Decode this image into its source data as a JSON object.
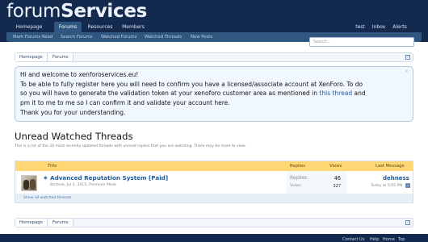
{
  "logo": {
    "prefix": "forum",
    "suffix": "Services"
  },
  "nav": {
    "tabs": [
      "Homepage",
      "Forums",
      "Resources",
      "Members"
    ],
    "account": [
      "test",
      "Inbox",
      "Alerts"
    ],
    "selected": "Forums"
  },
  "subnav": [
    "Mark Forums Read",
    "Search Forums",
    "Watched Forums",
    "Watched Threads",
    "New Posts"
  ],
  "search": {
    "placeholder": "Search..."
  },
  "breadcrumb": [
    "Homepage",
    "Forums"
  ],
  "notice": {
    "line1": "Hi and welcome to xenforoservices.eu!",
    "line2": "To be able to fully register here you will need to confirm you have a licensed/associate account at XenForo. To do",
    "line3": "so you will have to generate the validation token at your xenoforo customer area as mentioned in",
    "link": "this thread",
    "line3b": "and",
    "line4": "pm it to me to me so I can confirm it and validate your account here.",
    "line5": "Thank you for your understanding.",
    "close": "×"
  },
  "watched": {
    "title": "Unread Watched Threads",
    "description": "This is a list of the 20 most recently-updated threads with unread replies that you are watching. There may be more to view."
  },
  "table": {
    "headers": {
      "title": "Title",
      "replies": "Replies",
      "views": "Views",
      "last": "Last Message"
    },
    "row": {
      "title": "Advanced Reputation System [Paid]",
      "meta": "Borbole, Jul 5, 2015, Premium Mods",
      "replies_label": "Replies:",
      "replies": "46",
      "views_label": "Views:",
      "views": "327",
      "last_user": "dehness",
      "last_time": "Today at 5:05 PM"
    },
    "show_all": "Show all watched threads"
  },
  "footer": [
    "Contact Us",
    "Help",
    "Home",
    "Top"
  ],
  "colors": {
    "header": "#132a4e",
    "nav": "#305780",
    "accent": "#ffd775",
    "link": "#1f5c9e"
  }
}
